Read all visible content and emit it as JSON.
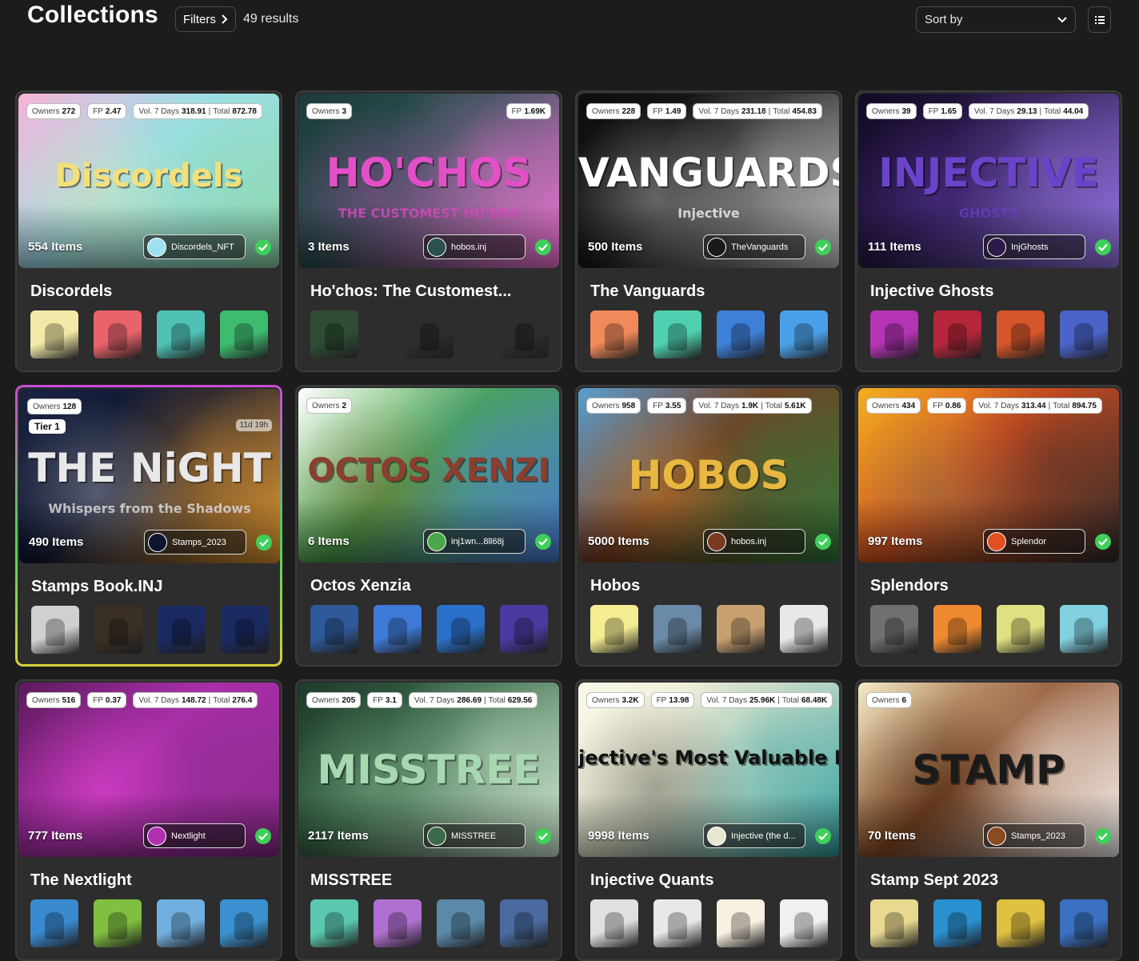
{
  "header": {
    "title": "Collections",
    "filters_label": "Filters",
    "results": "49 results",
    "sort_label": "Sort by"
  },
  "colors": {
    "background": "#1c1c1c",
    "card": "#2d2d2d",
    "verified": "#3fcf5a"
  },
  "collections": [
    {
      "name": "Discordels",
      "owners_label": "Owners",
      "owners": "272",
      "fp": "2.47",
      "vol7": "318.91",
      "total": "872.78",
      "items": "554 Items",
      "creator": "Discordels_NFT",
      "banner_text": "Discordels",
      "colors": [
        "#f7b3d6",
        "#9de0f0",
        "#f4e07a",
        "#8bd7a7"
      ],
      "thumb_colors": [
        "#f2e9a8",
        "#e9636b",
        "#4fc2b5",
        "#3dbb6f"
      ]
    },
    {
      "name": "Ho'chos: The Customest...",
      "owners_label": "Owners",
      "owners": "3",
      "fp": "1.69K",
      "items": "3 Items",
      "creator": "hobos.inj",
      "banner_text": "HO'CHOS",
      "banner_sub": "THE CUSTOMEST HO'BRO",
      "colors": [
        "#1d3b3a",
        "#2a5150",
        "#e34fc7",
        "#ff78e0"
      ],
      "thumb_colors": [
        "#2f4d35",
        "#2d2d2d",
        "#2d2d2d"
      ]
    },
    {
      "name": "The Vanguards",
      "owners_label": "Owners",
      "owners": "228",
      "fp": "1.49",
      "vol7": "231.18",
      "total": "454.83",
      "items": "500 Items",
      "creator": "TheVanguards",
      "banner_text": "VANGUARDS",
      "banner_sub": "Injective",
      "colors": [
        "#0d0d0d",
        "#1a1a1a",
        "#ffffff",
        "#cccccc"
      ],
      "thumb_colors": [
        "#f08a5a",
        "#4fd0b0",
        "#3e7fd8",
        "#4aa0e8"
      ]
    },
    {
      "name": "Injective Ghosts",
      "owners_label": "Owners",
      "owners": "39",
      "fp": "1.65",
      "vol7": "29.13",
      "total": "44.04",
      "items": "111 Items",
      "creator": "InjGhosts",
      "banner_text": "INJECTIVE",
      "banner_sub": "GHOSTS",
      "colors": [
        "#120a24",
        "#2b1a4a",
        "#6b43c9",
        "#9c7cf2"
      ],
      "thumb_colors": [
        "#b534b5",
        "#b5263a",
        "#d4562a",
        "#4a63c9"
      ]
    },
    {
      "name": "Stamps Book.INJ",
      "owners_label": "Owners",
      "owners": "128",
      "tier": "Tier 1",
      "countdown": "11d 19h",
      "items": "490 Items",
      "creator": "Stamps_2023",
      "banner_text": "THE NiGHT",
      "banner_sub": "Whispers from the Shadows",
      "colors": [
        "#1a2340",
        "#0d1530",
        "#e8e8e8",
        "#f0a030"
      ],
      "thumb_colors": [
        "#d0d0d0",
        "#3a2f24",
        "#1a2a60",
        "#1a2a60"
      ]
    },
    {
      "name": "Octos Xenzia",
      "owners_label": "Owners",
      "owners": "2",
      "items": "6 Items",
      "creator": "inj1wn...8ll68j",
      "banner_text": "OCTOS XENZI",
      "colors": [
        "#ffffff",
        "#4aa84a",
        "#8a3f2f",
        "#4a7ad8"
      ],
      "thumb_colors": [
        "#2f5a9a",
        "#3f7ad8",
        "#2a70c8",
        "#4a3aa0"
      ]
    },
    {
      "name": "Hobos",
      "owners_label": "Owners",
      "owners": "958",
      "fp": "3.55",
      "vol7": "1.9K",
      "total": "5.61K",
      "items": "5000 Items",
      "creator": "hobos.inj",
      "banner_text": "HOBOS",
      "colors": [
        "#5aa0d0",
        "#7a3a22",
        "#e8b840",
        "#2f7a3a"
      ],
      "thumb_colors": [
        "#f4ec90",
        "#6a8aa8",
        "#c8a070",
        "#e8e8e8"
      ]
    },
    {
      "name": "Splendors",
      "owners_label": "Owners",
      "owners": "434",
      "fp": "0.86",
      "vol7": "313.44",
      "total": "894.75",
      "items": "997 Items",
      "creator": "Splendor",
      "colors": [
        "#f0b020",
        "#e05020",
        "#4a8a5a",
        "#2a2a2a"
      ],
      "thumb_colors": [
        "#707070",
        "#f08a30",
        "#e0e080",
        "#80d0e0"
      ]
    },
    {
      "name": "The Nextlight",
      "owners_label": "Owners",
      "owners": "516",
      "fp": "0.37",
      "vol7": "148.72",
      "total": "276.4",
      "items": "777 Items",
      "creator": "Nextlight",
      "colors": [
        "#5a1a5a",
        "#b030b0",
        "#ff50e0",
        "#8a2a8a"
      ],
      "thumb_colors": [
        "#3a8ad0",
        "#80c040",
        "#70b0e0",
        "#3a90d0"
      ]
    },
    {
      "name": "MISSTREE",
      "owners_label": "Owners",
      "owners": "205",
      "fp": "3.1",
      "vol7": "286.69",
      "total": "629.56",
      "items": "2117 Items",
      "creator": "MISSTREE",
      "banner_text": "MISSTREE",
      "colors": [
        "#1f3a2a",
        "#3a6a4a",
        "#a8d8b0",
        "#d8f0d8"
      ],
      "thumb_colors": [
        "#5ac8b0",
        "#b070d0",
        "#5a8aa8",
        "#4a6aa0"
      ]
    },
    {
      "name": "Injective Quants",
      "owners_label": "Owners",
      "owners": "3.2K",
      "fp": "13.98",
      "vol7": "25.96K",
      "total": "68.48K",
      "items": "9998 Items",
      "creator": "Injective (the d...",
      "banner_text": "jective's Most Valuable Free N",
      "colors": [
        "#faf8e8",
        "#e8e8d0",
        "#111111",
        "#30a0a0"
      ],
      "thumb_colors": [
        "#e0e0e0",
        "#e8e8e8",
        "#f8f0e0",
        "#f0f0f0"
      ]
    },
    {
      "name": "Stamp Sept 2023",
      "owners_label": "Owners",
      "owners": "6",
      "items": "70 Items",
      "creator": "Stamps_2023",
      "banner_text": "STAMP",
      "colors": [
        "#f5ecc8",
        "#8a4a22",
        "#1a1a1a",
        "#ffffff"
      ],
      "thumb_colors": [
        "#e8d890",
        "#2a90d0",
        "#e0c040",
        "#3a70c0"
      ]
    }
  ],
  "labels": {
    "fp_prefix": "FP",
    "vol_prefix": "Vol. 7 Days",
    "total_prefix": "Total"
  }
}
